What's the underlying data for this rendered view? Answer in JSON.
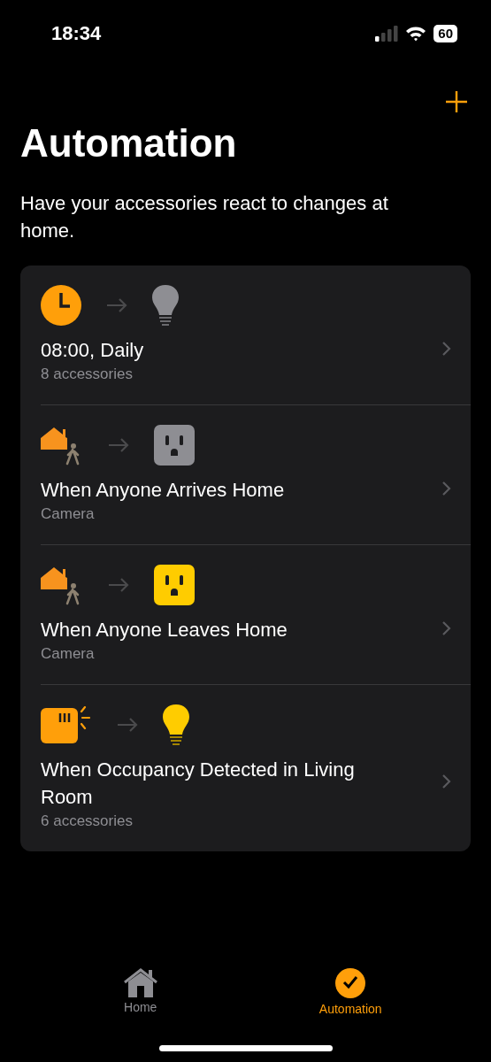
{
  "status_bar": {
    "time": "18:34",
    "battery": "60"
  },
  "title": "Automation",
  "subtitle": "Have your accessories react to changes at home.",
  "automations": [
    {
      "trigger": {
        "kind": "clock"
      },
      "target": {
        "kind": "bulb",
        "on": false
      },
      "title": "08:00, Daily",
      "detail": "8 accessories"
    },
    {
      "trigger": {
        "kind": "arrive"
      },
      "target": {
        "kind": "outlet",
        "on": false
      },
      "title": "When Anyone Arrives Home",
      "detail": "Camera"
    },
    {
      "trigger": {
        "kind": "leave"
      },
      "target": {
        "kind": "outlet",
        "on": true
      },
      "title": "When Anyone Leaves Home",
      "detail": "Camera"
    },
    {
      "trigger": {
        "kind": "sensor"
      },
      "target": {
        "kind": "bulb",
        "on": true
      },
      "title": "When Occupancy Detected in Living Room",
      "detail": "6 accessories"
    }
  ],
  "tabs": [
    {
      "label": "Home",
      "kind": "home",
      "selected": false
    },
    {
      "label": "Automation",
      "kind": "automation",
      "selected": true
    }
  ]
}
